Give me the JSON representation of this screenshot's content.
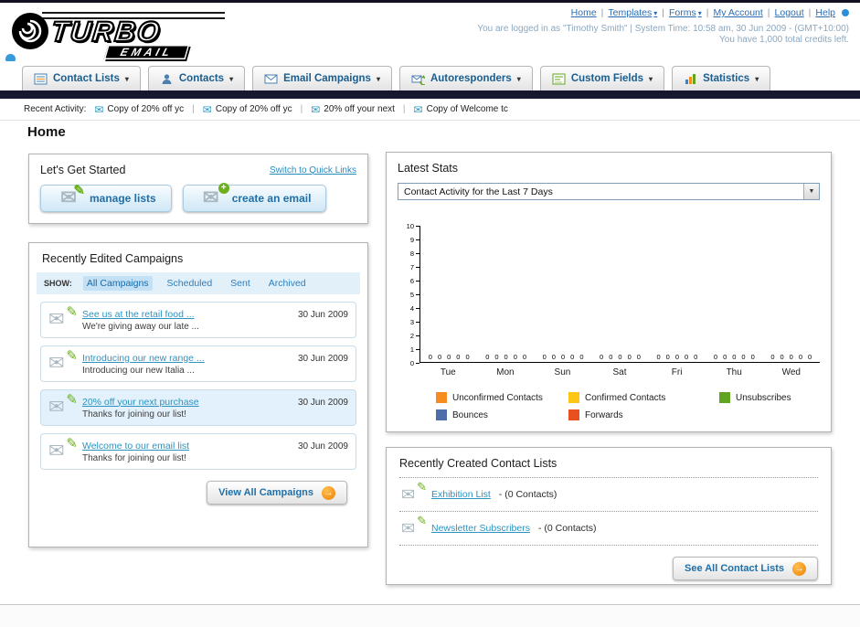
{
  "icons": {
    "dropdown_arrow": "▾",
    "select_arrow": "▼",
    "envelope": "✉",
    "pencil": "✎",
    "plus": "+",
    "arrow_right": "→"
  },
  "header": {
    "logo_line1": "TURBO",
    "logo_line2": "EMAIL",
    "top_links": [
      {
        "label": "Home"
      },
      {
        "label": "Templates"
      },
      {
        "label": "Forms"
      },
      {
        "label": "My Account"
      },
      {
        "label": "Logout"
      },
      {
        "label": "Help"
      }
    ],
    "login_info": "You are logged in as \"Timothy Smith\" | System Time: 10:58 am, 30 Jun 2009 - (GMT+10:00)",
    "credits": "You have 1,000 total credits left."
  },
  "nav": {
    "tabs": [
      {
        "label": "Contact Lists"
      },
      {
        "label": "Contacts"
      },
      {
        "label": "Email Campaigns"
      },
      {
        "label": "Autoresponders"
      },
      {
        "label": "Custom Fields"
      },
      {
        "label": "Statistics"
      }
    ]
  },
  "activity": {
    "label": "Recent Activity:",
    "items": [
      {
        "label": "Copy of 20% off yc"
      },
      {
        "label": "Copy of 20% off yc"
      },
      {
        "label": "20% off your next"
      },
      {
        "label": "Copy of Welcome tc"
      }
    ]
  },
  "page_title": "Home",
  "get_started": {
    "title": "Let's Get Started",
    "switch_link": "Switch to Quick Links",
    "manage_lists_label": "manage lists",
    "create_email_label": "create an email"
  },
  "campaigns": {
    "title": "Recently Edited Campaigns",
    "show_label": "SHOW:",
    "filters": [
      {
        "label": "All Campaigns",
        "active": true
      },
      {
        "label": "Scheduled",
        "active": false
      },
      {
        "label": "Sent",
        "active": false
      },
      {
        "label": "Archived",
        "active": false
      }
    ],
    "items": [
      {
        "title": "See us at the retail food ...",
        "subtitle": "We're giving away our late ...",
        "date": "30 Jun 2009"
      },
      {
        "title": "Introducing our new range ...",
        "subtitle": "Introducing our new Italia ...",
        "date": "30 Jun 2009"
      },
      {
        "title": "20% off your next purchase",
        "subtitle": "Thanks for joining our list!",
        "date": "30 Jun 2009"
      },
      {
        "title": "Welcome to our email list",
        "subtitle": "Thanks for joining our list!",
        "date": "30 Jun 2009"
      }
    ],
    "view_all_label": "View All Campaigns"
  },
  "stats": {
    "title": "Latest Stats",
    "period_selector": "Contact Activity for the Last 7 Days",
    "chart_data": {
      "type": "bar",
      "title": "Contact Activity for the Last 7 Days",
      "categories": [
        "Tue",
        "Mon",
        "Sun",
        "Sat",
        "Fri",
        "Thu",
        "Wed"
      ],
      "series": [
        {
          "name": "Unconfirmed Contacts",
          "color": "#f68b1f",
          "values": [
            0,
            0,
            0,
            0,
            0,
            0,
            0
          ]
        },
        {
          "name": "Confirmed Contacts",
          "color": "#fdc514",
          "values": [
            0,
            0,
            0,
            0,
            0,
            0,
            0
          ]
        },
        {
          "name": "Unsubscribes",
          "color": "#61a41f",
          "values": [
            0,
            0,
            0,
            0,
            0,
            0,
            0
          ]
        },
        {
          "name": "Bounces",
          "color": "#4d6ea8",
          "values": [
            0,
            0,
            0,
            0,
            0,
            0,
            0
          ]
        },
        {
          "name": "Forwards",
          "color": "#e8501f",
          "values": [
            0,
            0,
            0,
            0,
            0,
            0,
            0
          ]
        }
      ],
      "xlabel": "",
      "ylabel": "",
      "ylim": [
        0,
        10
      ],
      "grid": false,
      "legend_position": "bottom"
    }
  },
  "contact_lists": {
    "title": "Recently Created Contact Lists",
    "items": [
      {
        "name": "Exhibition List",
        "detail": "- (0 Contacts)"
      },
      {
        "name": "Newsletter Subscribers",
        "detail": "- (0 Contacts)"
      }
    ],
    "see_all_label": "See All Contact Lists"
  }
}
